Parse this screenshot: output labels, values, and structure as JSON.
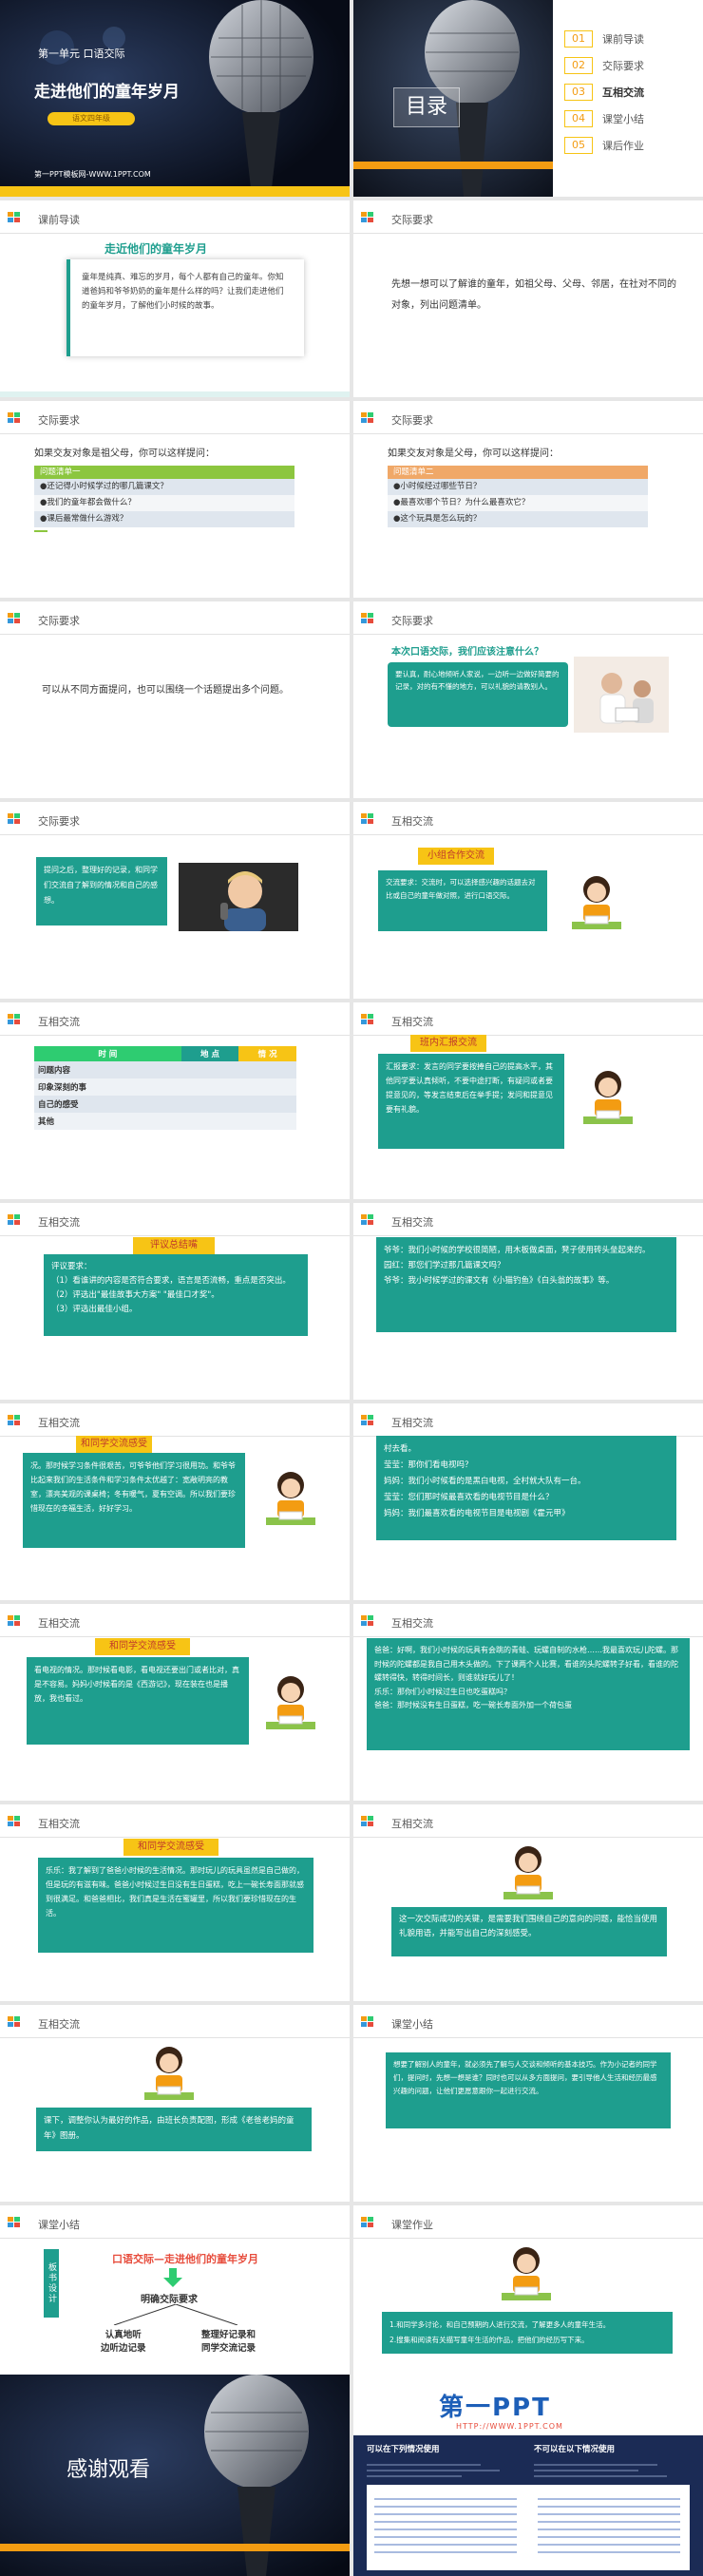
{
  "cover": {
    "unit": "第一单元 口语交际",
    "title": "走进他们的童年岁月",
    "badge": "语文四年级",
    "site": "第一PPT模板网-WWW.1PPT.COM"
  },
  "toc": {
    "title": "目录",
    "items": [
      {
        "num": "01",
        "label": "课前导读"
      },
      {
        "num": "02",
        "label": "交际要求"
      },
      {
        "num": "03",
        "label": "互相交流"
      },
      {
        "num": "04",
        "label": "课堂小结"
      },
      {
        "num": "05",
        "label": "课后作业"
      }
    ]
  },
  "s3": {
    "header": "课前导读",
    "title": "走近他们的童年岁月",
    "body": "童年是纯真、难忘的岁月，每个人都有自己的童年。你知道爸妈和爷爷奶奶的童年是什么样的吗？让我们走进他们的童年岁月，了解他们小时候的故事。"
  },
  "s4": {
    "header": "交际要求",
    "body": "先想一想可以了解谁的童年，如祖父母、父母、邻居，在社对不同的对象，列出问题清单。"
  },
  "s5": {
    "header": "交际要求",
    "lead": "如果交友对象是祖父母，你可以这样提问：",
    "listTitle": "问题清单一",
    "items": [
      "●还记得小时候学过的哪几篇课文？",
      "●我们的童年都会做什么？",
      "●课后最常做什么游戏？"
    ]
  },
  "s6": {
    "header": "交际要求",
    "lead": "如果交友对象是父母，你可以这样提问：",
    "listTitle": "问题清单二",
    "items": [
      "●小时候经过哪些节日？",
      "●最喜欢哪个节日？为什么最喜欢它？",
      "●这个玩具是怎么玩的？"
    ]
  },
  "s7": {
    "header": "交际要求",
    "body": "可以从不同方面提问，也可以围绕一个话题提出多个问题。"
  },
  "s8": {
    "header": "交际要求",
    "question": "本次口语交际，我们应该注意什么？",
    "body": "要认真，耐心地倾听人家说，一边听一边做好简要的记录，对的有不懂的地方，可以礼貌的请教别人。"
  },
  "s9": {
    "header": "交际要求",
    "body": "提问之后，整理好的记录，和同学们交流自了解到的情况和自己的感想。"
  },
  "s10": {
    "header": "互相交流",
    "tag": "小组合作交流",
    "body": "交流要求：交流时，可以选择感兴趣的话题去对比或自己的童年做对照，进行口语交际。"
  },
  "s11": {
    "header": "互相交流",
    "cols": [
      "时 间",
      "地 点",
      "情 况"
    ],
    "rows": [
      "问题内容",
      "印象深刻的事",
      "自己的感受",
      "其他"
    ]
  },
  "s12": {
    "header": "互相交流",
    "tag": "班内汇报交流",
    "body": "汇报要求：发言的同学要按捧自己的提高水平，其他同学要认真倾听，不要中途打断，有疑问或者要提意见的，等发言结束后在举手提；发问和提意见要有礼貌。"
  },
  "s13": {
    "header": "互相交流",
    "tag": "评议总结嘴",
    "body": "评议要求：\n（1）看谁讲的内容是否符合要求，语言是否流畅，重点是否突出。\n（2）评选出\"最佳故事大方案\" \"最佳口才奖\"。\n（3）评选出最佳小组。"
  },
  "s14": {
    "header": "互相交流",
    "body": "爷爷：我们小时候的学校很简陋，用木板做桌面，凳子使用砖头垒起来的。\n园红：那您们学过那几篇课文吗？\n爷爷：我小时候学过的课文有《小猫钓鱼》《白头翁的故事》等。"
  },
  "s15": {
    "header": "互相交流",
    "tag": "和同学交流感受",
    "body": "况。那时候学习条件很艰苦，可爷爷他们学习很用功。和爷爷比起来我们的生活条件和学习条件太优越了：宽敞明亮的教室，漂亮美观的课桌椅；冬有暖气，夏有空调。所以我们要珍惜现在的幸福生活，好好学习。"
  },
  "s16": {
    "header": "互相交流",
    "body": "村去看。\n莹莹：那你们看电视吗？\n妈妈：我们小时候看的是黑白电视，全村就大队有一台。\n莹莹：您们那时候最喜欢看的电视节目是什么？\n妈妈：我们最喜欢看的电视节目是电视剧《霍元甲》"
  },
  "s17": {
    "header": "互相交流",
    "tag": "和同学交流感受",
    "body": "看电视的情况。那时候看电影，看电视还要出门或者比对，真是不容易。妈妈小时候看的是《西游记》，现在装在也是播放，我也看过。"
  },
  "s18": {
    "header": "互相交流",
    "body": "爸爸：好啊，我们小时候的玩具有会跳的青蛙、玩螺自制的水枪……我最喜欢玩儿陀螺。那时候的陀螺都是我自己用木头做的。下了课两个人比赛，看谁的头陀螺转子好看，看谁的陀螺转得快，转得时间长，则谁就好玩儿了！\n乐乐：那你们小时候过生日也吃蛋糕吗？\n爸爸：那时候没有生日蛋糕，吃一碗长寿面外加一个荷包蛋"
  },
  "s19": {
    "header": "互相交流",
    "tag": "和同学交流感受",
    "body": "乐乐：我了解到了爸爸小时候的生活情况。那时玩儿的玩具虽然是自己做的，但是玩的有滋有味。爸爸小时候过生日没有生日蛋糕，吃上一碗长寿面那就感到很满足。和爸爸相比，我们真是生活在蜜罐里，所以我们要珍惜现在的生活。"
  },
  "s20": {
    "header": "互相交流",
    "body": "这一次交际成功的关键，是需要我们围绕自己的意向的问题，能恰当使用礼貌用语，并能写出自己的深刻感受。"
  },
  "s21": {
    "header": "互相交流",
    "body": "课下，调整你认为最好的作品，由班长负责配图，形成《老爸老妈的童年》图册。"
  },
  "s22": {
    "header": "课堂小结",
    "body": "想要了解别人的童年，就必须先了解与人交谈和倾听的基本技巧。作为小记者的同学们，提问时，先想一想是谁？同时也可以从多方面提问，要引导他人生活和经历最感兴趣的问题，让他们更愿意跟你一起进行交流。"
  },
  "s23": {
    "header": "课堂小结",
    "side": "板书设计",
    "title": "口语交际—走进他们的童年岁月",
    "mid": "明确交际要求",
    "left": "认真地听\n边听边记录",
    "right": "整理好记录和\n同学交流记录"
  },
  "s24": {
    "header": "课堂作业",
    "items": [
      "1.和同学多讨论，和自己预期的人进行交流，了解更多人的童年生活。",
      "2.搜集和阅读有关描写童年生活的作品，把他们的经历写下来。"
    ]
  },
  "s25": {
    "title": "感谢观看"
  },
  "s26": {
    "brand": "第一PPT",
    "url": "HTTP://WWW.1PPT.COM",
    "left_head": "可以在下列情况使用",
    "right_head": "不可以在以下情况使用"
  },
  "colors": {
    "teal": "#1e9e8e",
    "yellow": "#f7c415",
    "orange": "#f39c12",
    "green": "#2ecc71"
  }
}
